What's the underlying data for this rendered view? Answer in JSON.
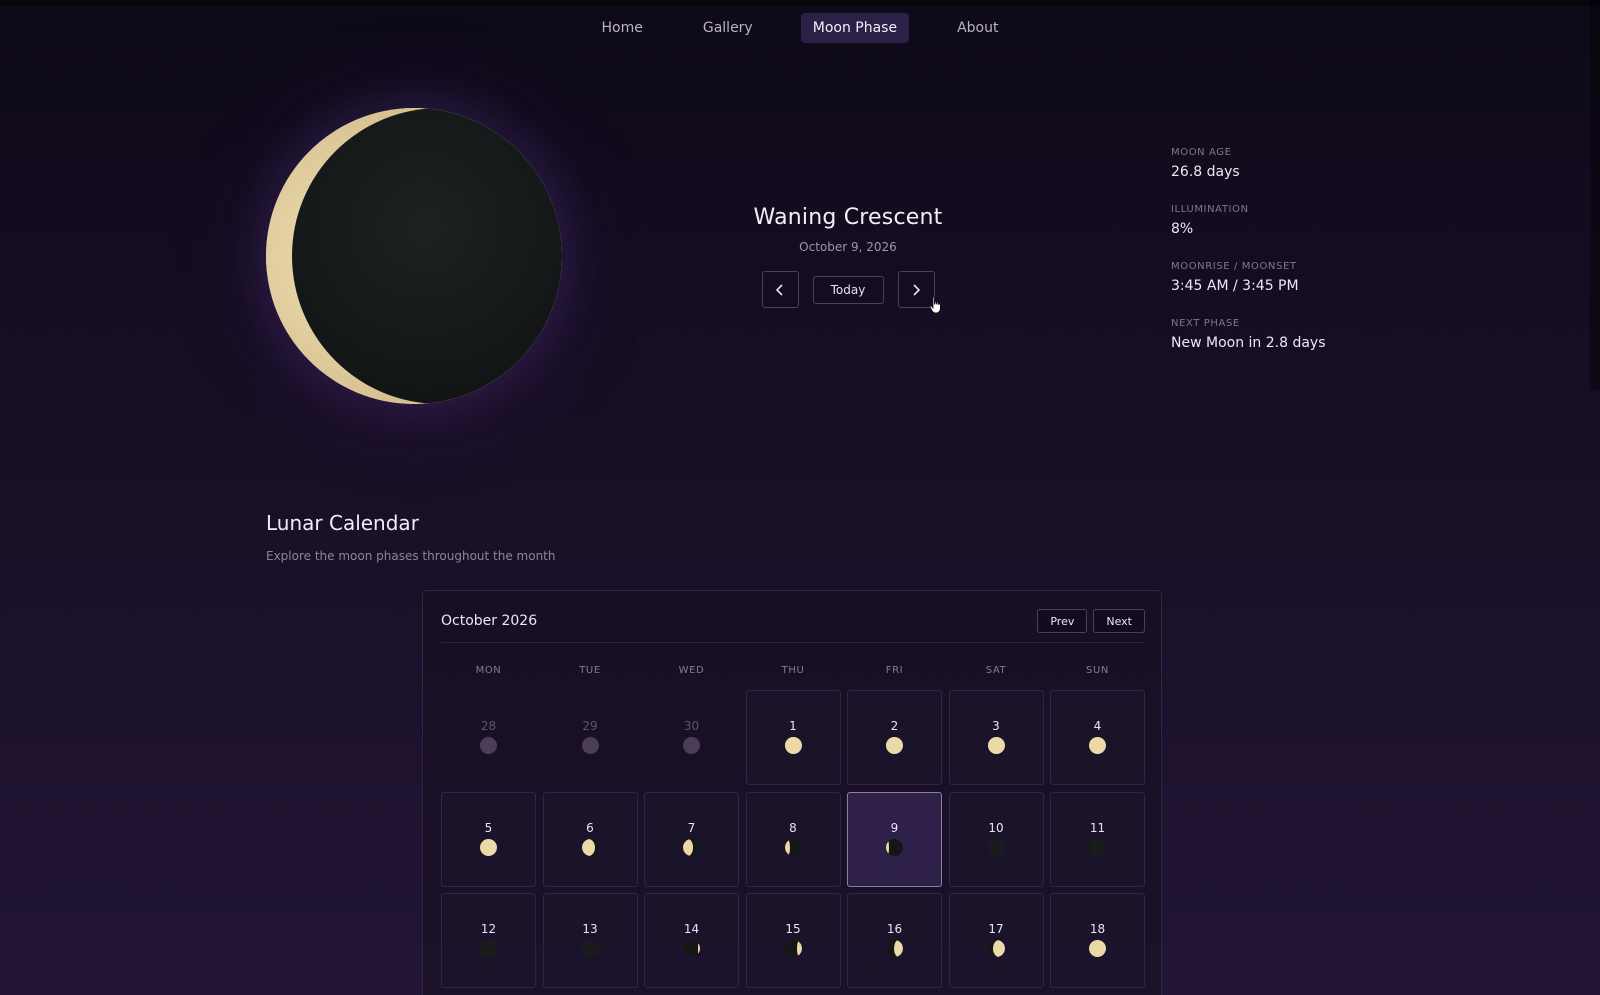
{
  "nav": {
    "items": [
      {
        "label": "Home",
        "active": false
      },
      {
        "label": "Gallery",
        "active": false
      },
      {
        "label": "Moon Phase",
        "active": true
      },
      {
        "label": "About",
        "active": false
      }
    ]
  },
  "phase": {
    "name": "Waning Crescent",
    "date": "October 9, 2026",
    "prev_icon": "chevron-left-icon",
    "today_label": "Today",
    "next_icon": "chevron-right-icon",
    "illumination_fraction": 0.08
  },
  "stats": [
    {
      "label": "MOON AGE",
      "value": "26.8 days"
    },
    {
      "label": "ILLUMINATION",
      "value": "8%"
    },
    {
      "label": "MOONRISE / MOONSET",
      "value": "3:45 AM / 3:45 PM"
    },
    {
      "label": "NEXT PHASE",
      "value": "New Moon in 2.8 days"
    }
  ],
  "calendar": {
    "title": "Lunar Calendar",
    "subtitle": "Explore the moon phases throughout the month",
    "month": "October 2026",
    "prev_label": "Prev",
    "next_label": "Next",
    "weekdays": [
      "MON",
      "TUE",
      "WED",
      "THU",
      "FRI",
      "SAT",
      "SUN"
    ],
    "days": [
      {
        "num": "28",
        "muted": true,
        "phase": "dim"
      },
      {
        "num": "29",
        "muted": true,
        "phase": "dim"
      },
      {
        "num": "30",
        "muted": true,
        "phase": "dim"
      },
      {
        "num": "1",
        "phase": "waning-gibbous-large"
      },
      {
        "num": "2",
        "phase": "waning-gibbous"
      },
      {
        "num": "3",
        "phase": "waning-gibbous-small"
      },
      {
        "num": "4",
        "phase": "last-quarter"
      },
      {
        "num": "5",
        "phase": "last-quarter"
      },
      {
        "num": "6",
        "phase": "waning-crescent-large"
      },
      {
        "num": "7",
        "phase": "waning-crescent"
      },
      {
        "num": "8",
        "phase": "waning-crescent-thin"
      },
      {
        "num": "9",
        "phase": "waning-crescent-hair",
        "selected": true
      },
      {
        "num": "10",
        "phase": "new"
      },
      {
        "num": "11",
        "phase": "new"
      },
      {
        "num": "12",
        "phase": "new"
      },
      {
        "num": "13",
        "phase": "new"
      },
      {
        "num": "14",
        "phase": "waxing-hair"
      },
      {
        "num": "15",
        "phase": "waxing-thin"
      },
      {
        "num": "16",
        "phase": "waxing-crescent"
      },
      {
        "num": "17",
        "phase": "waxing-crescent-large"
      },
      {
        "num": "18",
        "phase": "first-quarter"
      }
    ]
  }
}
